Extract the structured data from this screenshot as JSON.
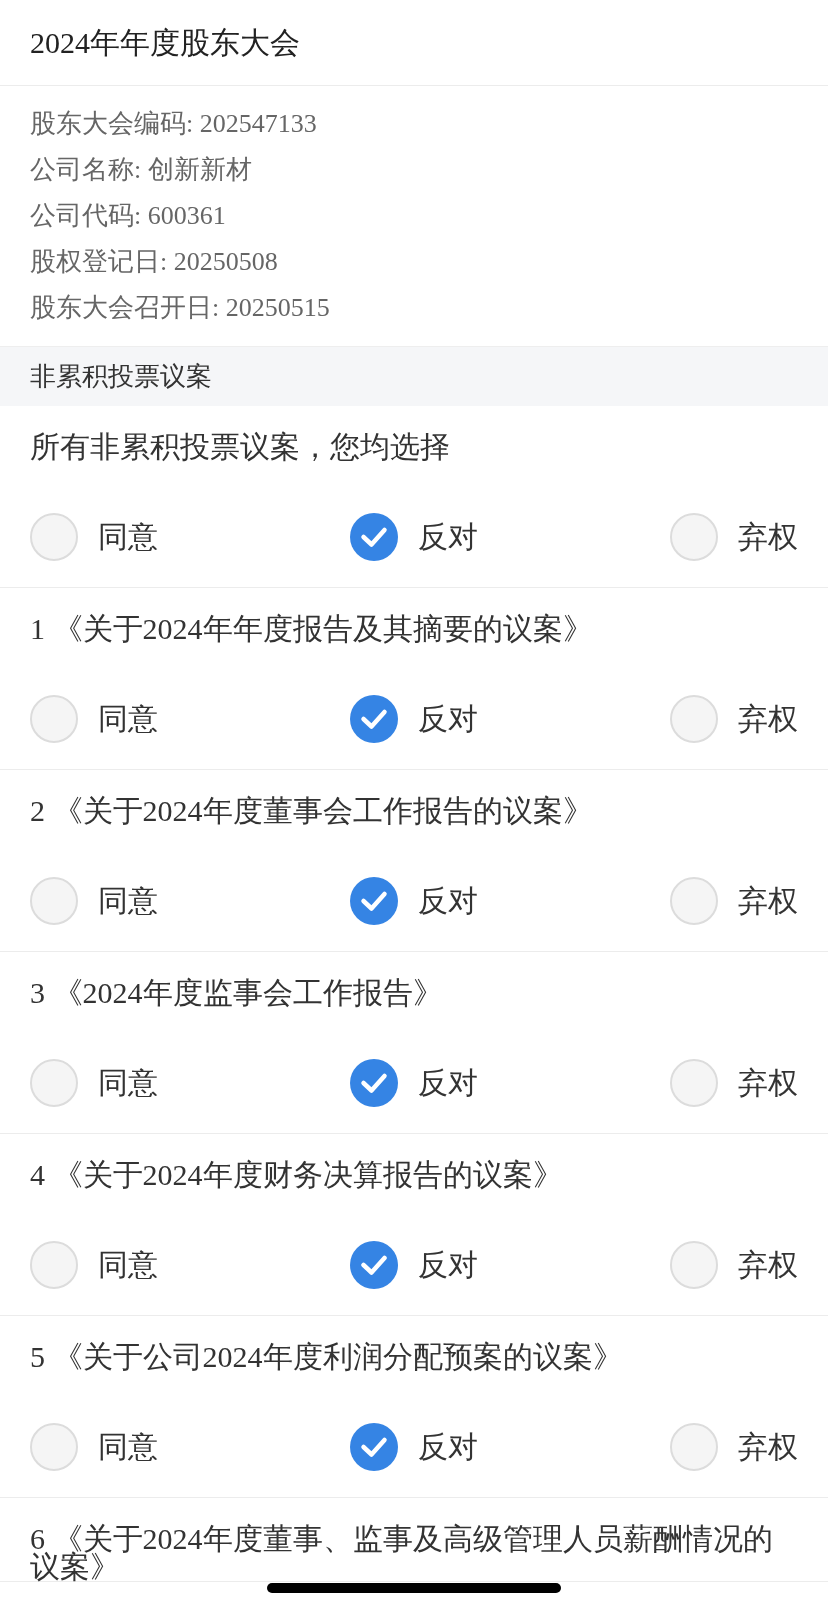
{
  "header": {
    "title": "2024年年度股东大会"
  },
  "meeting_info": [
    "股东大会编码: 202547133",
    "公司名称: 创新新材",
    "公司代码: 600361",
    "股权登记日: 20250508",
    "股东大会召开日: 20250515"
  ],
  "section": {
    "title": "非累积投票议案"
  },
  "bulk_vote": {
    "prompt": "所有非累积投票议案，您均选择",
    "options": [
      {
        "label": "同意",
        "selected": false
      },
      {
        "label": "反对",
        "selected": true
      },
      {
        "label": "弃权",
        "selected": false
      }
    ]
  },
  "proposals": [
    {
      "title": "1 《关于2024年年度报告及其摘要的议案》",
      "options": [
        {
          "label": "同意",
          "selected": false
        },
        {
          "label": "反对",
          "selected": true
        },
        {
          "label": "弃权",
          "selected": false
        }
      ]
    },
    {
      "title": "2 《关于2024年度董事会工作报告的议案》",
      "options": [
        {
          "label": "同意",
          "selected": false
        },
        {
          "label": "反对",
          "selected": true
        },
        {
          "label": "弃权",
          "selected": false
        }
      ]
    },
    {
      "title": "3 《2024年度监事会工作报告》",
      "options": [
        {
          "label": "同意",
          "selected": false
        },
        {
          "label": "反对",
          "selected": true
        },
        {
          "label": "弃权",
          "selected": false
        }
      ]
    },
    {
      "title": "4 《关于2024年度财务决算报告的议案》",
      "options": [
        {
          "label": "同意",
          "selected": false
        },
        {
          "label": "反对",
          "selected": true
        },
        {
          "label": "弃权",
          "selected": false
        }
      ]
    },
    {
      "title": "5 《关于公司2024年度利润分配预案的议案》",
      "options": [
        {
          "label": "同意",
          "selected": false
        },
        {
          "label": "反对",
          "selected": true
        },
        {
          "label": "弃权",
          "selected": false
        }
      ]
    },
    {
      "title": "6 《关于2024年度董事、监事及高级管理人员薪酬情况的议案》"
    }
  ]
}
